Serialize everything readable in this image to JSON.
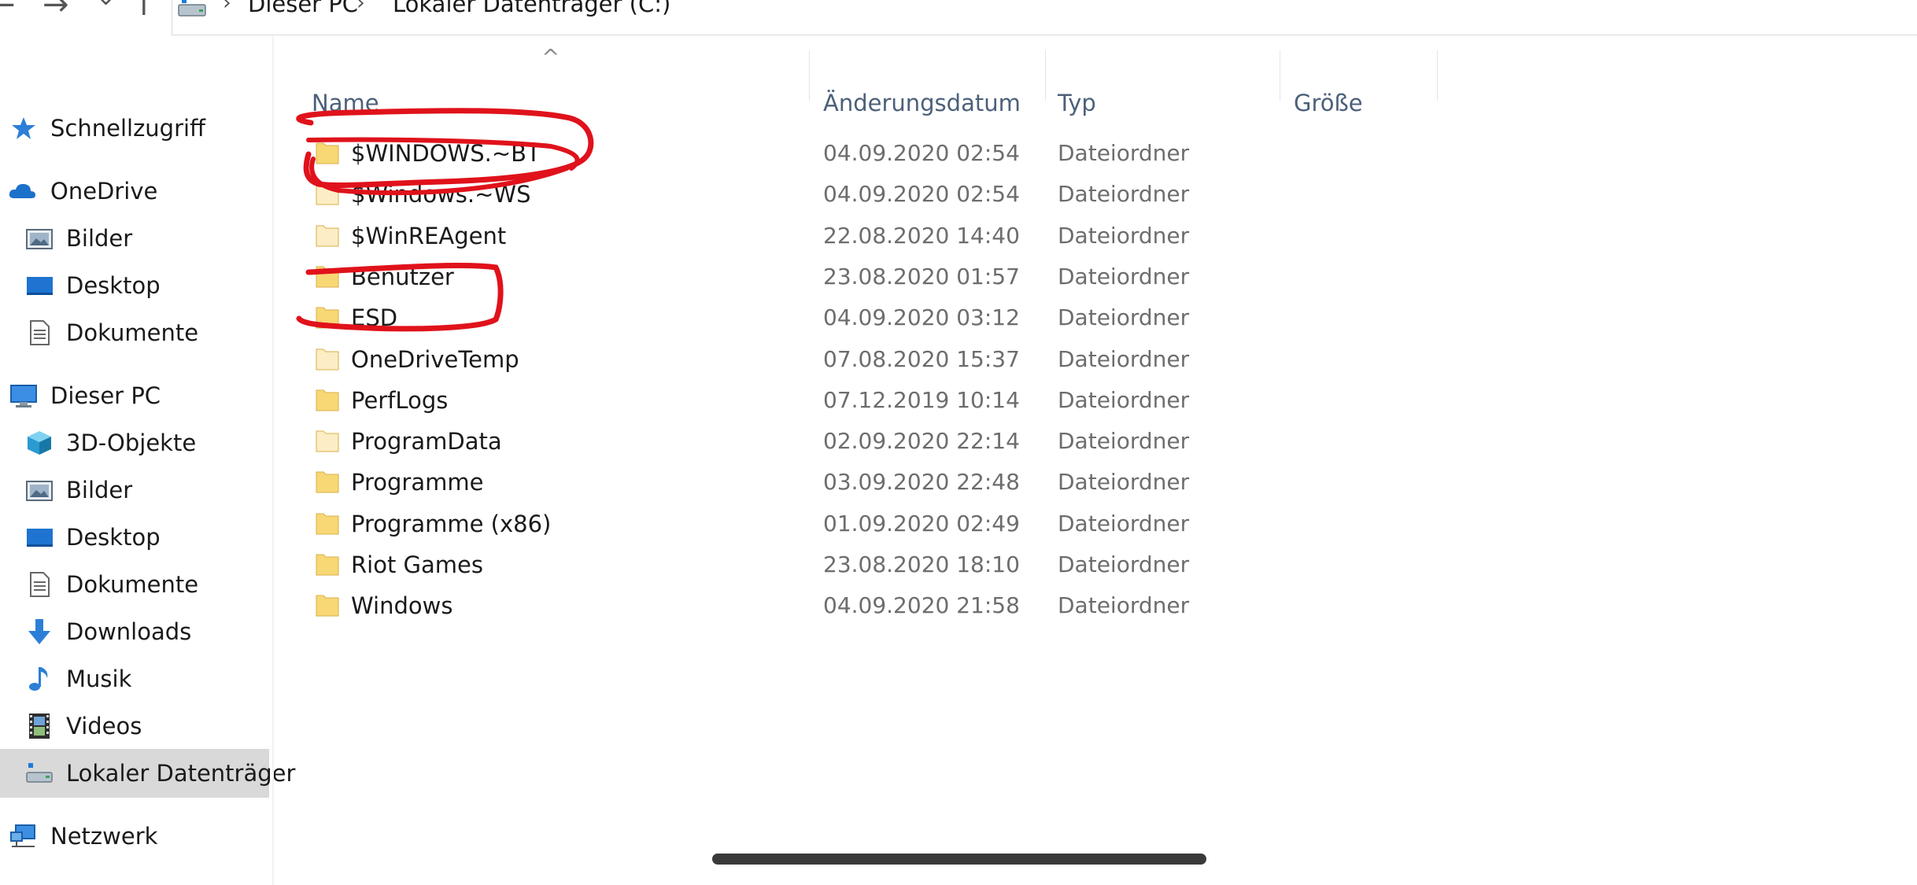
{
  "window": {
    "breadcrumb": [
      "Dieser PC",
      "Lokaler Datenträger (C:)"
    ],
    "breadcrumb_separator": "›",
    "nav_buttons": [
      "back-arrow-icon",
      "forward-arrow-icon",
      "history-chevron-icon",
      "up-arrow-icon"
    ]
  },
  "sidebar": {
    "items": [
      {
        "label": "Schnellzugriff",
        "icon": "star-icon"
      },
      {
        "label": "OneDrive",
        "icon": "cloud-icon"
      },
      {
        "label": "Bilder",
        "icon": "pictures-icon"
      },
      {
        "label": "Desktop",
        "icon": "desktop-icon"
      },
      {
        "label": "Dokumente",
        "icon": "document-icon"
      },
      {
        "label": "Dieser PC",
        "icon": "computer-icon"
      },
      {
        "label": "3D-Objekte",
        "icon": "cube-icon"
      },
      {
        "label": "Bilder",
        "icon": "pictures-icon"
      },
      {
        "label": "Desktop",
        "icon": "desktop-icon"
      },
      {
        "label": "Dokumente",
        "icon": "document-icon"
      },
      {
        "label": "Downloads",
        "icon": "download-arrow-icon"
      },
      {
        "label": "Musik",
        "icon": "music-note-icon"
      },
      {
        "label": "Videos",
        "icon": "film-icon"
      },
      {
        "label": "Lokaler Datenträger",
        "icon": "drive-icon"
      },
      {
        "label": "Netzwerk",
        "icon": "network-icon"
      }
    ],
    "selected_index": 13
  },
  "columns": {
    "name": "Name",
    "date": "Änderungsdatum",
    "type": "Typ",
    "size": "Größe"
  },
  "files": [
    {
      "name": "$WINDOWS.~BT",
      "date": "04.09.2020 02:54",
      "type": "Dateiordner",
      "hidden": false
    },
    {
      "name": "$Windows.~WS",
      "date": "04.09.2020 02:54",
      "type": "Dateiordner",
      "hidden": true
    },
    {
      "name": "$WinREAgent",
      "date": "22.08.2020 14:40",
      "type": "Dateiordner",
      "hidden": true
    },
    {
      "name": "Benutzer",
      "date": "23.08.2020 01:57",
      "type": "Dateiordner",
      "hidden": false
    },
    {
      "name": "ESD",
      "date": "04.09.2020 03:12",
      "type": "Dateiordner",
      "hidden": false
    },
    {
      "name": "OneDriveTemp",
      "date": "07.08.2020 15:37",
      "type": "Dateiordner",
      "hidden": true
    },
    {
      "name": "PerfLogs",
      "date": "07.12.2019 10:14",
      "type": "Dateiordner",
      "hidden": false
    },
    {
      "name": "ProgramData",
      "date": "02.09.2020 22:14",
      "type": "Dateiordner",
      "hidden": true
    },
    {
      "name": "Programme",
      "date": "03.09.2020 22:48",
      "type": "Dateiordner",
      "hidden": false
    },
    {
      "name": "Programme (x86)",
      "date": "01.09.2020 02:49",
      "type": "Dateiordner",
      "hidden": false
    },
    {
      "name": "Riot Games",
      "date": "23.08.2020 18:10",
      "type": "Dateiordner",
      "hidden": false
    },
    {
      "name": "Windows",
      "date": "04.09.2020 21:58",
      "type": "Dateiordner",
      "hidden": false
    }
  ],
  "colors": {
    "folder": "#f8d775",
    "folder_hidden": "#fcedc4",
    "annotation": "#e0121b",
    "selected_bg": "#d9d9d9",
    "header_text": "#4c607a"
  }
}
